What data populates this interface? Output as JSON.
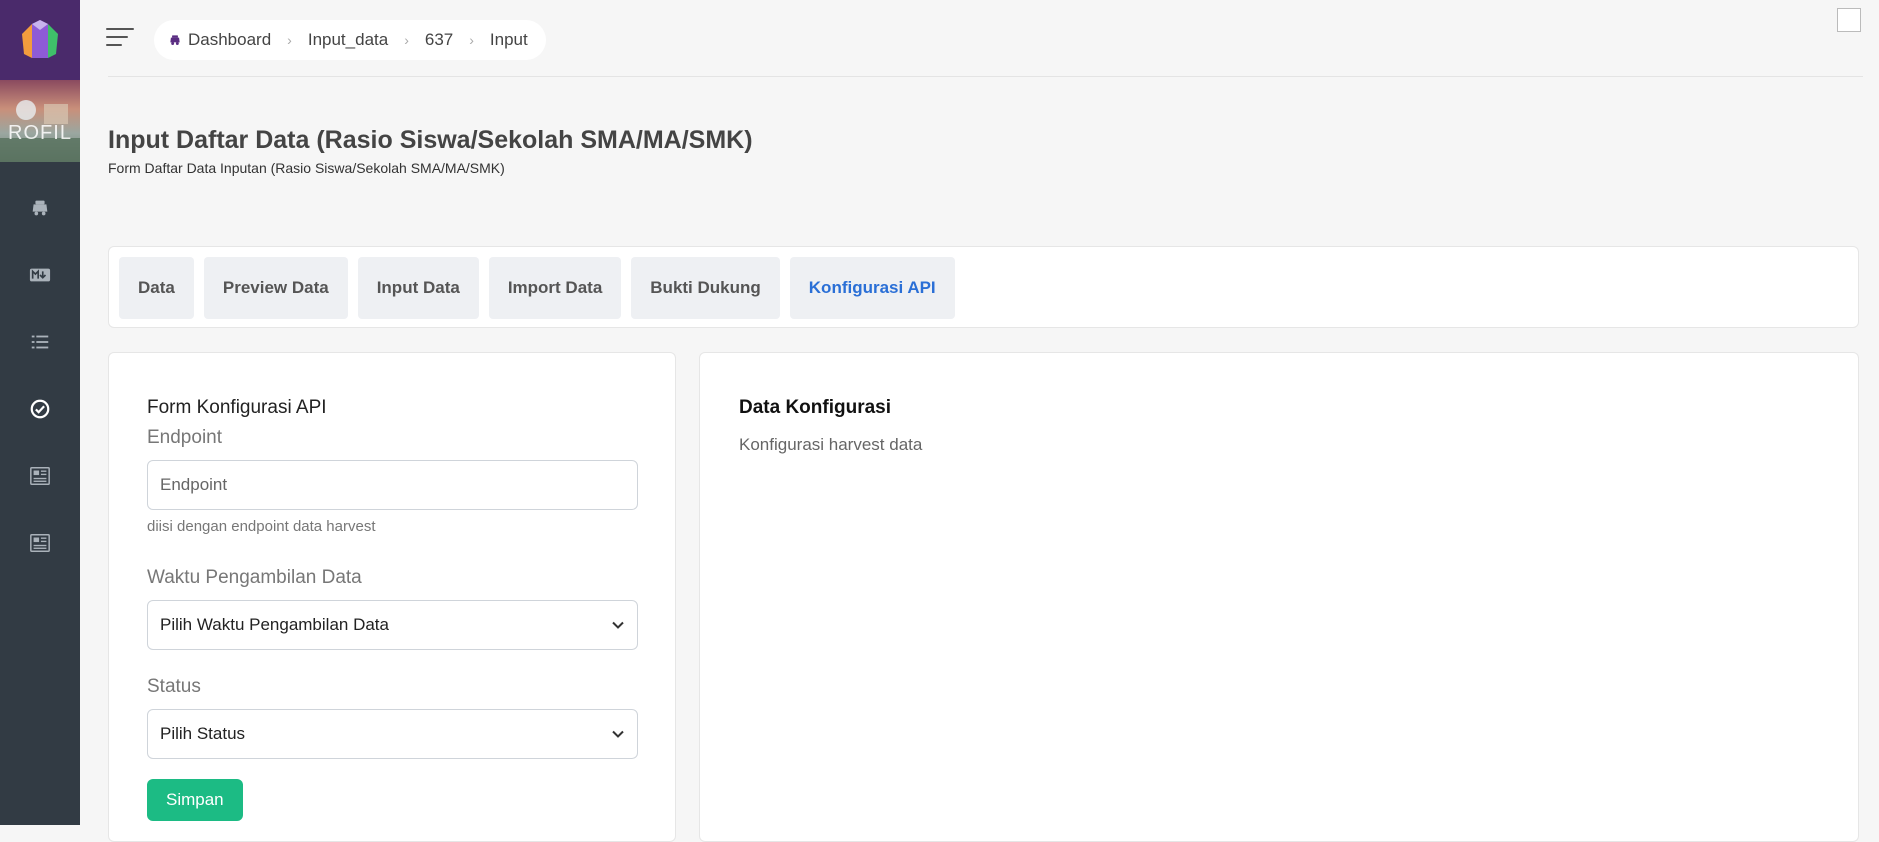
{
  "sidebar": {
    "banner_text": "ROFIL",
    "nav": [
      {
        "icon": "dashboard-icon"
      },
      {
        "icon": "markdown-icon"
      },
      {
        "icon": "list-icon"
      },
      {
        "icon": "check-circle-icon"
      },
      {
        "icon": "document-icon"
      },
      {
        "icon": "document-icon"
      }
    ]
  },
  "breadcrumb": {
    "items": [
      "Dashboard",
      "Input_data",
      "637",
      "Input"
    ]
  },
  "page": {
    "title": "Input Daftar Data (Rasio Siswa/Sekolah SMA/MA/SMK)",
    "subtitle": "Form Daftar Data Inputan (Rasio Siswa/Sekolah SMA/MA/SMK)"
  },
  "tabs": [
    {
      "label": "Data",
      "active": false
    },
    {
      "label": "Preview Data",
      "active": false
    },
    {
      "label": "Input Data",
      "active": false
    },
    {
      "label": "Import Data",
      "active": false
    },
    {
      "label": "Bukti Dukung",
      "active": false
    },
    {
      "label": "Konfigurasi API",
      "active": true
    }
  ],
  "form": {
    "title": "Form Konfigurasi API",
    "endpoint_label": "Endpoint",
    "endpoint_placeholder": "Endpoint",
    "endpoint_value": "",
    "endpoint_help": "diisi dengan endpoint data harvest",
    "waktu_label": "Waktu Pengambilan Data",
    "waktu_selected": "Pilih Waktu Pengambilan Data",
    "status_label": "Status",
    "status_selected": "Pilih Status",
    "save_label": "Simpan"
  },
  "config": {
    "title": "Data Konfigurasi",
    "subtitle": "Konfigurasi harvest data"
  },
  "colors": {
    "sidebar_bg": "#323b44",
    "logo_bg": "#4a2a6b",
    "active_tab": "#2a6fd6",
    "save_button": "#1cbb84"
  }
}
